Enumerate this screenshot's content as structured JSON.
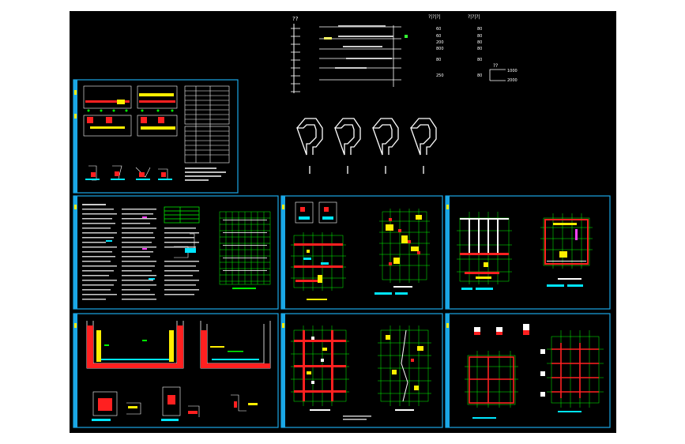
{
  "viewport": {
    "label": "cad-model-space"
  },
  "colors": {
    "background": "#000000",
    "frame": "#1aa7e6",
    "grid": "#00ff00",
    "wall": "#ff2020",
    "fill": "#ffee00",
    "note": "#ffffff",
    "cyan": "#00e5ff",
    "magenta": "#ff40ff"
  },
  "top_note": {
    "legend_head": "??",
    "col_head_1": "?|?|?|",
    "col_head_2": "?|?|?|",
    "values_a": [
      "60",
      "60",
      "200",
      "800",
      "80",
      "250"
    ],
    "values_b": [
      "80",
      "80",
      "80",
      "80",
      "80",
      "80"
    ],
    "side_label": "??",
    "side_values": [
      "1000",
      "2000"
    ]
  },
  "placeholder_glyph": "?",
  "sheets": [
    {
      "name": "sheet-index",
      "icon": "drawing-index-sheet"
    },
    {
      "name": "sheet-general-notes",
      "icon": "notes-sheet"
    },
    {
      "name": "sheet-plan-1",
      "icon": "plan-sheet"
    },
    {
      "name": "sheet-plan-2",
      "icon": "plan-sheet"
    },
    {
      "name": "sheet-pool-section",
      "icon": "section-sheet"
    },
    {
      "name": "sheet-plan-3",
      "icon": "plan-sheet"
    },
    {
      "name": "sheet-plan-4",
      "icon": "plan-sheet"
    }
  ]
}
